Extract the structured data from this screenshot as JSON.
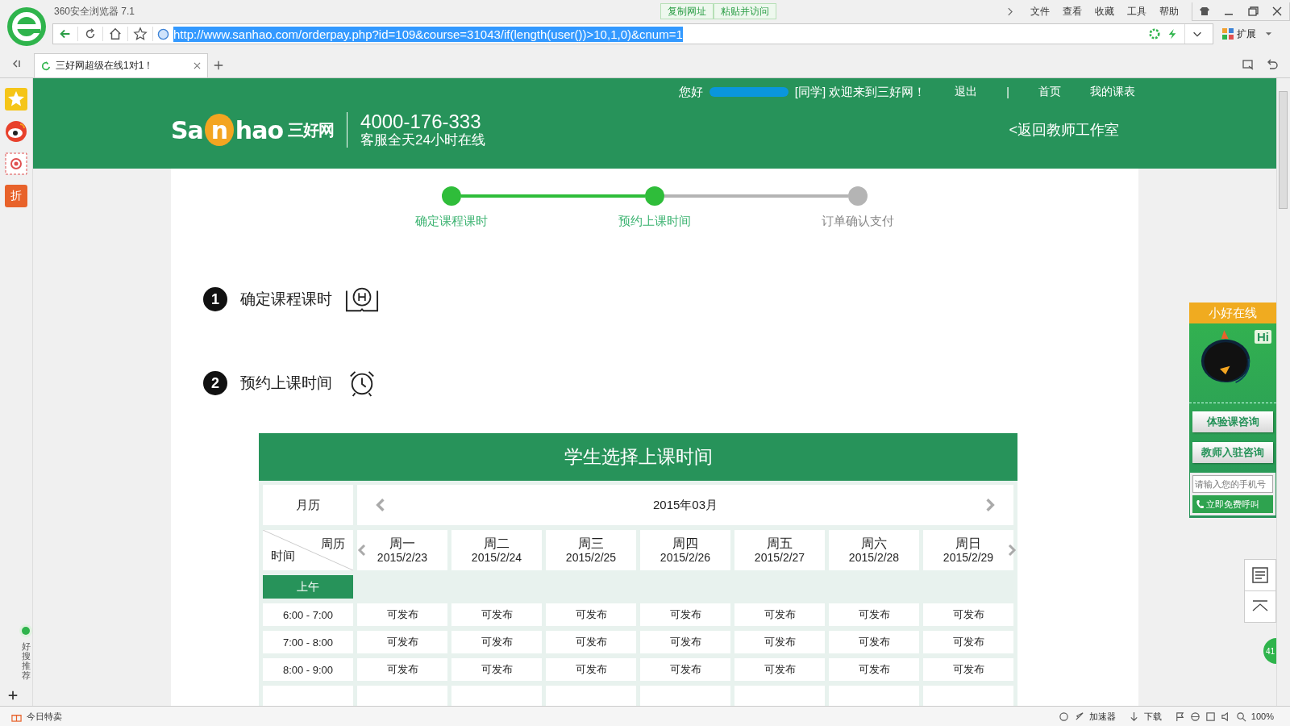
{
  "browser": {
    "title": "360安全浏览器 7.1",
    "copy_buttons": [
      "复制网址",
      "粘贴并访问"
    ],
    "menu": [
      "文件",
      "查看",
      "收藏",
      "工具",
      "帮助"
    ],
    "url": "http://www.sanhao.com/orderpay.php?id=109&course=31043/if(length(user())>10,1,0)&cnum=1",
    "extend": "扩展",
    "tabs": [
      {
        "title": "三好网超级在线1对1！",
        "selected": true
      }
    ],
    "sidebar_badge": "折",
    "sidebar_label": "好搜推荐",
    "status_left": "今日特卖",
    "status_items": [
      "加速器",
      "下载"
    ],
    "zoom": "100%"
  },
  "header": {
    "greeting": "您好",
    "welcome": "[同学] 欢迎来到三好网！",
    "links": [
      "退出",
      "|",
      "首页",
      "我的课表"
    ],
    "logo_parts": [
      "Sa",
      "n",
      "hao",
      "三好网"
    ],
    "phone": "4000-176-333",
    "service": "客服全天24小时在线",
    "back_link": "<返回教师工作室"
  },
  "steps": [
    {
      "label": "确定课程课时",
      "done": true
    },
    {
      "label": "预约上课时间",
      "done": true
    },
    {
      "label": "订单确认支付",
      "done": false
    }
  ],
  "sections": [
    {
      "number": "1",
      "title": "确定课程课时",
      "kind": "book"
    },
    {
      "number": "2",
      "title": "预约上课时间",
      "kind": "clock"
    }
  ],
  "schedule": {
    "title": "学生选择上课时间",
    "calendar_label": "月历",
    "month": "2015年03月",
    "corner_top": "周历",
    "corner_bottom": "时间",
    "days": [
      {
        "name": "周一",
        "date": "2015/2/23"
      },
      {
        "name": "周二",
        "date": "2015/2/24"
      },
      {
        "name": "周三",
        "date": "2015/2/25"
      },
      {
        "name": "周四",
        "date": "2015/2/26"
      },
      {
        "name": "周五",
        "date": "2015/2/27"
      },
      {
        "name": "周六",
        "date": "2015/2/28"
      },
      {
        "name": "周日",
        "date": "2015/2/29"
      }
    ],
    "period": "上午",
    "rows": [
      {
        "time": "6:00 - 7:00",
        "slots": [
          "可发布",
          "可发布",
          "可发布",
          "可发布",
          "可发布",
          "可发布",
          "可发布"
        ]
      },
      {
        "time": "7:00 - 8:00",
        "slots": [
          "可发布",
          "可发布",
          "可发布",
          "可发布",
          "可发布",
          "可发布",
          "可发布"
        ]
      },
      {
        "time": "8:00 - 9:00",
        "slots": [
          "可发布",
          "可发布",
          "可发布",
          "可发布",
          "可发布",
          "可发布",
          "可发布"
        ]
      }
    ]
  },
  "widget": {
    "title": "小好在线",
    "hi": "Hi",
    "buttons": [
      "体验课咨询",
      "教师入驻咨询"
    ],
    "phone_placeholder": "请输入您的手机号",
    "call": "立即免费呼叫"
  },
  "float_badge": "41"
}
